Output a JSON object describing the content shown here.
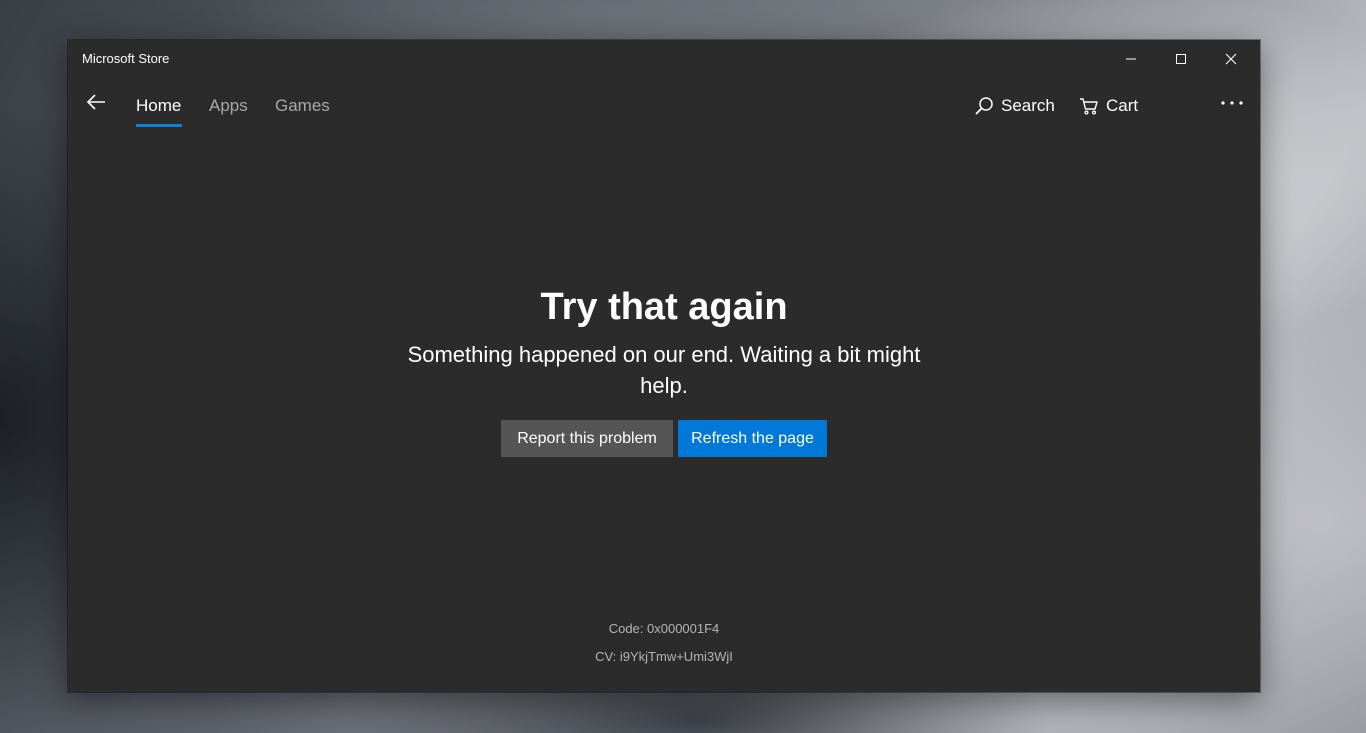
{
  "window": {
    "title": "Microsoft Store"
  },
  "caption_buttons": {
    "minimize_icon": "minimize-icon",
    "maximize_icon": "maximize-icon",
    "close_icon": "close-icon"
  },
  "nav": {
    "back_icon": "back-arrow-icon",
    "tabs": [
      {
        "label": "Home",
        "active": true
      },
      {
        "label": "Apps",
        "active": false
      },
      {
        "label": "Games",
        "active": false
      }
    ],
    "search_label": "Search",
    "search_icon": "search-icon",
    "cart_label": "Cart",
    "cart_icon": "cart-icon",
    "more_icon": "more-icon"
  },
  "error": {
    "title": "Try that again",
    "message": "Something happened on our end. Waiting a bit might help.",
    "report_button": "Report this problem",
    "refresh_button": "Refresh the page",
    "code": "Code: 0x000001F4",
    "cv": "CV: i9YkjTmw+Umi3WjI"
  },
  "colors": {
    "window_bg": "#2b2b2b",
    "accent": "#0078d7",
    "tab_underline": "#0a84d6",
    "secondary_button": "#555555",
    "muted_text": "#b4b4b4"
  }
}
